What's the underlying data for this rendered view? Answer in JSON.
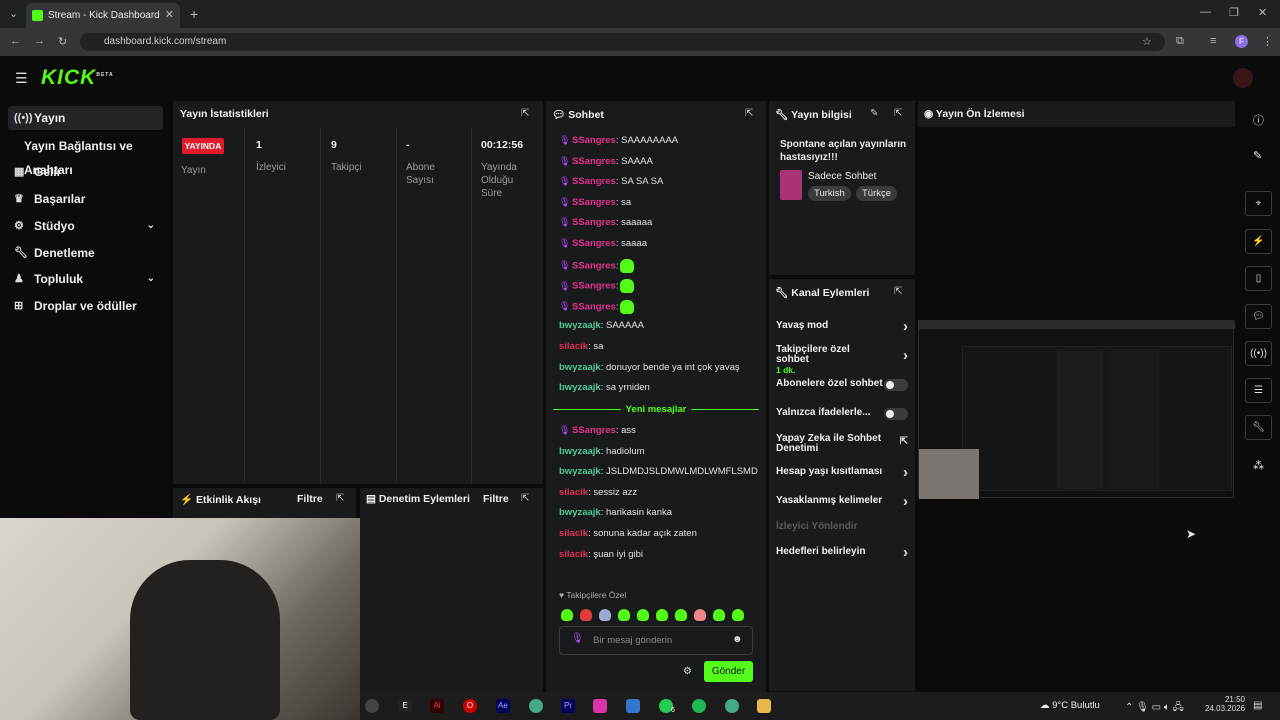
{
  "browser": {
    "tab_title": "Stream - Kick Dashboard",
    "url": "dashboard.kick.com/stream",
    "profile_initial": "F"
  },
  "logo": {
    "text": "KICK",
    "badge": "BETA"
  },
  "sidebar": {
    "items": [
      {
        "label": "Yayın",
        "icon": "broadcast-icon"
      },
      {
        "label": "Yayın Bağlantısı ve Anahtarı"
      },
      {
        "label": "Gelir",
        "icon": "chart-icon"
      },
      {
        "label": "Başarılar",
        "icon": "trophy-icon"
      },
      {
        "label": "Stüdyo",
        "icon": "studio-icon"
      },
      {
        "label": "Denetleme",
        "icon": "wrench-icon"
      },
      {
        "label": "Topluluk",
        "icon": "community-icon"
      },
      {
        "label": "Droplar ve ödüller",
        "icon": "drops-icon"
      }
    ]
  },
  "stats": {
    "title": "Yayın İstatistikleri",
    "live_badge": "YAYINDA",
    "columns": [
      {
        "value": "",
        "label": "Yayın"
      },
      {
        "value": "1",
        "label": "İzleyici"
      },
      {
        "value": "9",
        "label": "Takipçi"
      },
      {
        "value": "-",
        "label": "Abone Sayısı"
      },
      {
        "value": "00:12:56",
        "label": "Yayında Olduğu Süre"
      }
    ]
  },
  "activity": {
    "title": "Etkinlik Akışı",
    "filter": "Filtre"
  },
  "moderation": {
    "title": "Denetim Eylemleri",
    "filter": "Filtre"
  },
  "chat": {
    "title": "Sohbet",
    "messages_before": [
      {
        "user": "SSangres",
        "text": ": SAAAAAAAA",
        "style": "u1",
        "mic": true
      },
      {
        "user": "SSangres",
        "text": ": SAAAA",
        "style": "u1",
        "mic": true
      },
      {
        "user": "SSangres",
        "text": ": SA SA SA",
        "style": "u1",
        "mic": true
      },
      {
        "user": "SSangres",
        "text": ": sa",
        "style": "u1",
        "mic": true
      },
      {
        "user": "SSangres",
        "text": ": saaaaa",
        "style": "u1",
        "mic": true
      },
      {
        "user": "SSangres",
        "text": ": saaaa",
        "style": "u1",
        "mic": true
      },
      {
        "user": "SSangres",
        "text": ":",
        "style": "u1",
        "mic": true,
        "emote": true
      },
      {
        "user": "SSangres",
        "text": ":",
        "style": "u1",
        "mic": true,
        "emote": true
      },
      {
        "user": "SSangres",
        "text": ":",
        "style": "u1",
        "mic": true,
        "emote": true
      },
      {
        "user": "bwyzaajk",
        "text": ": SAAAAA",
        "style": "u2"
      },
      {
        "user": "silacik",
        "text": ": sa",
        "style": "u3"
      },
      {
        "user": "bwyzaajk",
        "text": ": donuyor bende ya int çok yavaş",
        "style": "u2"
      },
      {
        "user": "bwyzaajk",
        "text": ": sa yrniden",
        "style": "u2"
      }
    ],
    "new_messages_label": "Yeni mesajlar",
    "messages_after": [
      {
        "user": "SSangres",
        "text": ": ass",
        "style": "u1",
        "mic": true
      },
      {
        "user": "bwyzaajk",
        "text": ": hadiolum",
        "style": "u2"
      },
      {
        "user": "bwyzaajk",
        "text": ": JSLDMDJSLDMWLMDLWMFLSMD",
        "style": "u2"
      },
      {
        "user": "silacik",
        "text": ": sessiz azz",
        "style": "u3"
      },
      {
        "user": "bwyzaajk",
        "text": ": harikasin kanka",
        "style": "u2"
      },
      {
        "user": "silacik",
        "text": ": sonuna kadar açık zaten",
        "style": "u3"
      },
      {
        "user": "silacik",
        "text": ": şuan iyi gibi",
        "style": "u3"
      }
    ],
    "followers_only": "Takipçilere Özel",
    "input_placeholder": "Bir mesaj gönderin",
    "send_label": "Gönder"
  },
  "stream_info": {
    "title": "Yayın bilgisi",
    "stream_title": "Spontane açılan yayınların hastasıyız!!!",
    "category": "Sadece Sohbet",
    "tags": [
      "Turkish",
      "Türkçe"
    ]
  },
  "channel_actions": {
    "title": "Kanal Eylemleri",
    "items": [
      {
        "label": "Yavaş mod",
        "kind": "arrow"
      },
      {
        "label": "Takipçilere özel sohbet",
        "sub": "1 dk.",
        "kind": "arrow"
      },
      {
        "label": "Abonelere özel sohbet",
        "kind": "toggle"
      },
      {
        "label": "Yalnızca ifadelerle...",
        "kind": "toggle"
      },
      {
        "label": "Yapay Zeka ile Sohbet Denetimi",
        "kind": "external"
      },
      {
        "label": "Hesap yaşı kısıtlaması",
        "kind": "arrow"
      },
      {
        "label": "Yasaklanmış kelimeler",
        "kind": "arrow"
      },
      {
        "label": "İzleyici Yönlendir",
        "kind": "disabled"
      },
      {
        "label": "Hedefleri belirleyin",
        "kind": "arrow"
      }
    ]
  },
  "preview": {
    "title": "Yayın Ön İzlemesi"
  },
  "taskbar": {
    "weather": "9°C Bulutlu",
    "time": "21:50",
    "date": "24.03.2026",
    "whatsapp_badge": "6"
  },
  "colors": {
    "accent": "#53fc18",
    "live": "#e0192b",
    "panel": "#191a1c"
  }
}
